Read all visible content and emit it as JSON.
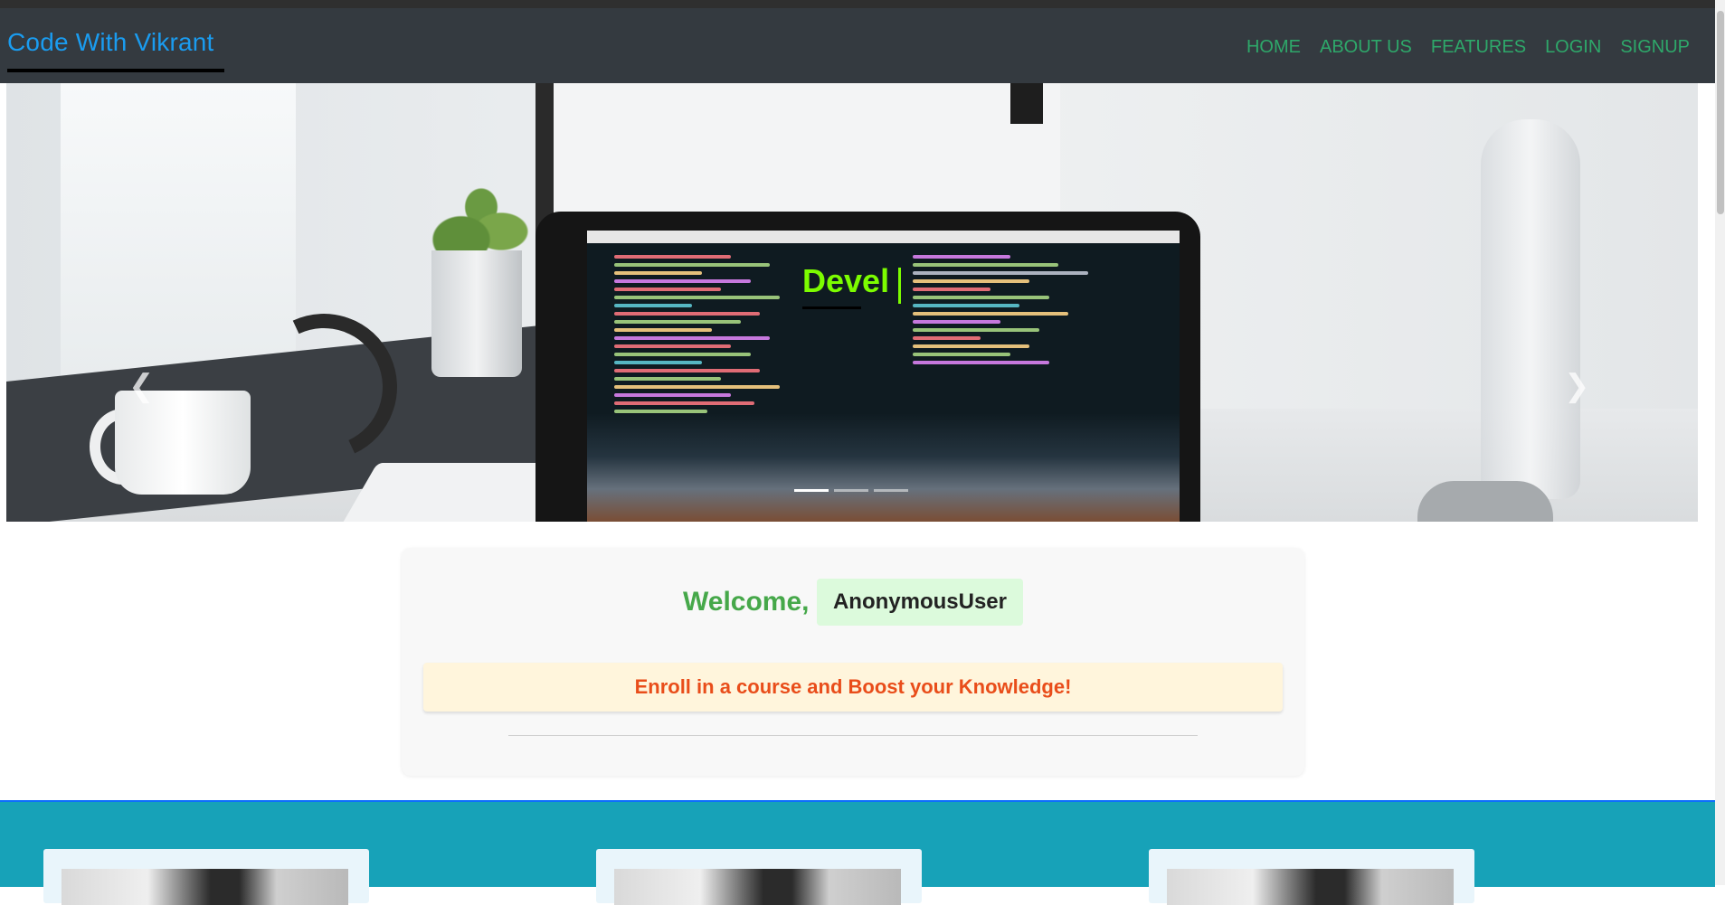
{
  "navbar": {
    "brand": "Code With Vikrant",
    "links": [
      "HOME",
      "ABOUT US",
      "FEATURES",
      "LOGIN",
      "SIGNUP"
    ]
  },
  "hero": {
    "caption": "Devel",
    "prev_icon": "chevron-left-icon",
    "next_icon": "chevron-right-icon",
    "indicator_count": 3,
    "active_indicator": 1
  },
  "welcome": {
    "greeting": "Welcome,",
    "username": "AnonymousUser",
    "enroll_text": "Enroll in a course and Boost your Knowledge!"
  },
  "colors": {
    "navbar_bg": "#343a40",
    "brand": "#1a9cf0",
    "nav_link": "#2ea86a",
    "caption": "#7cfc00",
    "welcome": "#46a84a",
    "enroll_text": "#e94d1a",
    "courses_bg": "#17a2b8"
  }
}
